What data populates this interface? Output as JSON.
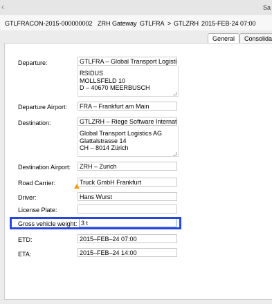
{
  "toolbar": {
    "save_label": "Sa"
  },
  "header": {
    "consignment": "GTLFRACON-2015-000000002",
    "gateway": "ZRH Gateway",
    "route_from": "GTLFRA",
    "route_arrow": ">",
    "route_to": "GTLZRH",
    "datetime": "2015-FEB-24 07:00"
  },
  "tabs": {
    "general": "General",
    "consolidation": "Consolidat"
  },
  "form": {
    "departure": {
      "label": "Departure:",
      "value": "GTLFRA – Global Transport Logistic",
      "address": "RSIDUS\nMOLLSFELD 10\nD – 40670 MEERBUSCH"
    },
    "departure_airport": {
      "label": "Departure Airport:",
      "value": "FRA – Frankfurt am Main"
    },
    "destination": {
      "label": "Destination:",
      "value": "GTLZRH – Riege Software Internatic",
      "address": "Global Transport Logistics AG\nGlattalstrasse 14\nCH – 8014 Zürich"
    },
    "destination_airport": {
      "label": "Destination Airport:",
      "value": "ZRH – Zurich"
    },
    "road_carrier": {
      "label": "Road Carrier:",
      "value": "Truck GmbH Frankfurt"
    },
    "driver": {
      "label": "Driver:",
      "value": "Hans Wurst"
    },
    "license_plate": {
      "label": "License Plate:",
      "value": ""
    },
    "gross_vehicle_weight": {
      "label": "Gross vehicle weight:",
      "value": "3 t"
    },
    "etd": {
      "label": "ETD:",
      "value": "2015–FEB–24 07:00"
    },
    "eta": {
      "label": "ETA:",
      "value": "2015–FEB–24 14:00"
    }
  }
}
